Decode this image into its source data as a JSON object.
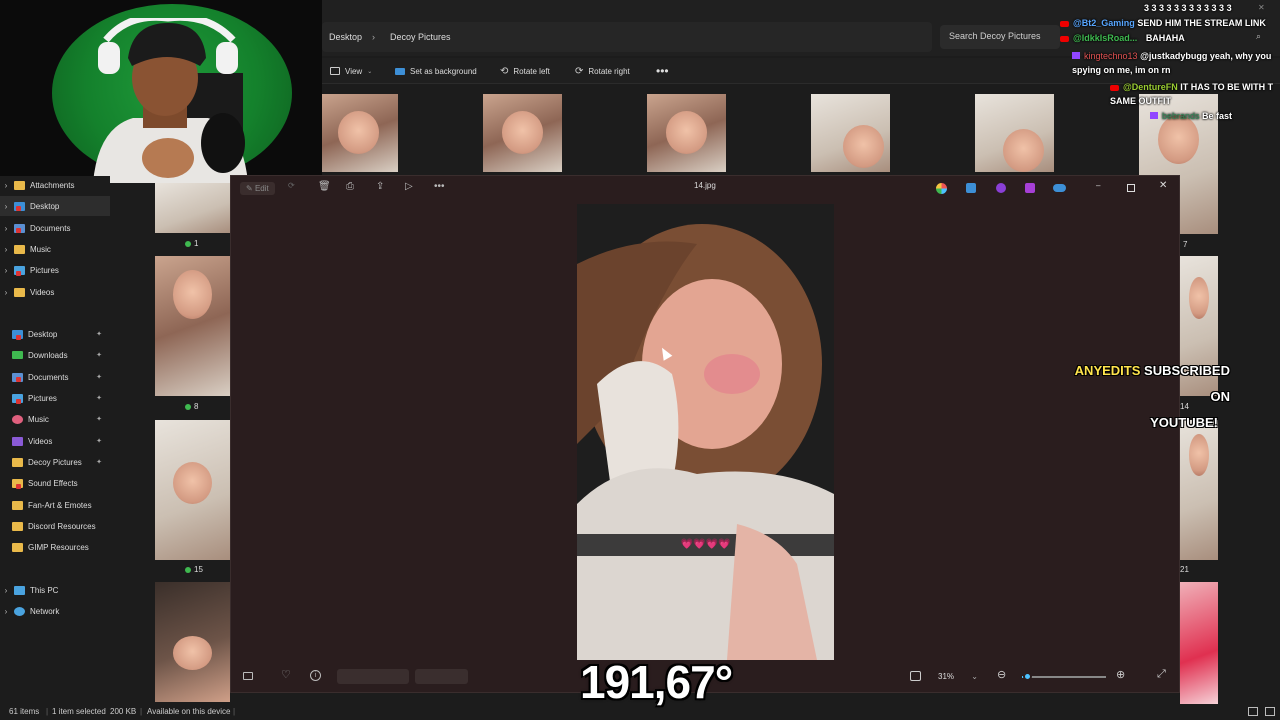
{
  "explorer": {
    "breadcrumb": [
      "Desktop",
      "Decoy Pictures"
    ],
    "search_placeholder": "Search Decoy Pictures",
    "commands": [
      "View",
      "Set as background",
      "Rotate left",
      "Rotate right"
    ],
    "sidebar_top": [
      {
        "label": "Attachments",
        "type": "folder"
      },
      {
        "label": "Desktop",
        "type": "desktop",
        "selected": true
      },
      {
        "label": "Documents",
        "type": "docs"
      },
      {
        "label": "Music",
        "type": "folder"
      },
      {
        "label": "Pictures",
        "type": "pictures"
      },
      {
        "label": "Videos",
        "type": "folder"
      }
    ],
    "quick_access": [
      "Desktop",
      "Downloads",
      "Documents",
      "Pictures",
      "Music",
      "Videos",
      "Decoy Pictures",
      "Sound Effects",
      "Fan-Art & Emotes",
      "Discord Resources",
      "GIMP Resources"
    ],
    "drives": [
      "This PC",
      "Network"
    ],
    "thumb_labels": [
      "1",
      "8",
      "15",
      "7",
      "14",
      "21"
    ],
    "status": {
      "items": "61 items",
      "selected": "1 item selected",
      "size": "200 KB",
      "availability": "Available on this device"
    }
  },
  "viewer": {
    "title": "14.jpg",
    "edit_label": "Edit",
    "zoom": "31%",
    "zoom_fraction": 0.0,
    "photo_caption": "💗💗💗💗"
  },
  "chat": [
    {
      "user": "",
      "text": "3 3 3 3 3 3 3 3 3 3 3 3",
      "platform": "none"
    },
    {
      "user": "@Bt2_Gaming",
      "text": "SEND HIM THE STREAM LINK",
      "platform": "youtube",
      "color": "#58a6ff"
    },
    {
      "user": "@IdkkIsRoad...",
      "text": "BAHAHA",
      "platform": "youtube",
      "color": "#3fb950"
    },
    {
      "user": "kingtechno13",
      "text": "@justkadybugg yeah, why you spying on me, im on rn",
      "platform": "twitch",
      "color": "#e05252"
    },
    {
      "user": "@DentureFN",
      "text": "IT HAS TO BE WITH T SAME OUTFIT",
      "platform": "youtube",
      "color": "#9acd32"
    },
    {
      "user": "bebrands",
      "text": "Be fast",
      "platform": "twitch",
      "color": "#2e8b57"
    }
  ],
  "overlay": {
    "counter": "191,67°",
    "banner_line1_highlight": "ANYEDITS",
    "banner_line1_rest": "SUBSCRIBED ON",
    "banner_line2": "YOUTUBE!"
  },
  "colors": {
    "accent": "#4cc2ff",
    "viewer_bg": "#2a1d1e",
    "green_screen": "#14812c"
  }
}
